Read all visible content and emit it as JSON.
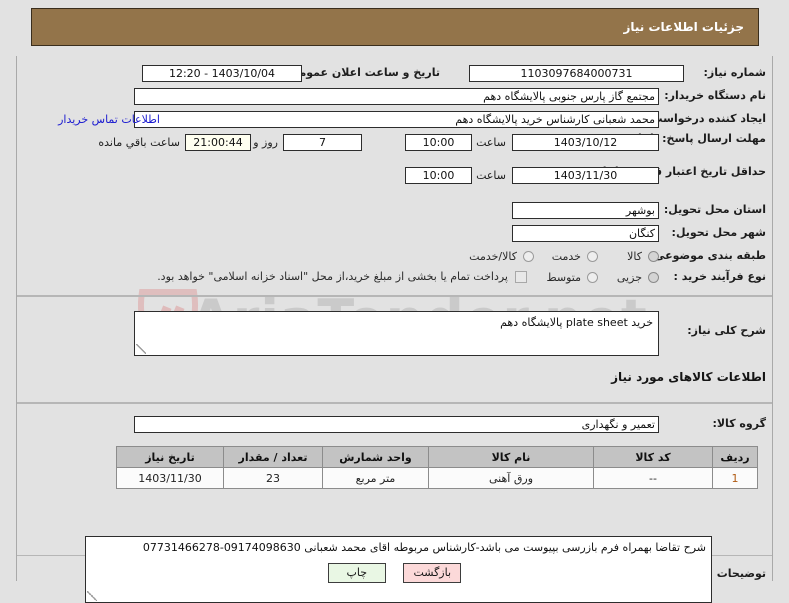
{
  "header": {
    "title": "جزئیات اطلاعات نیاز"
  },
  "info": {
    "need_number": {
      "label": "شماره نیاز:",
      "value": "1103097684000731"
    },
    "announce_datetime": {
      "label": "تاریخ و ساعت اعلان عمومی:",
      "value": "1403/10/04 - 12:20"
    },
    "buyer_org": {
      "label": "نام دستگاه خریدار:",
      "value": "مجتمع گاز پارس جنوبی  پالایشگاه دهم"
    },
    "creator": {
      "label": "ایجاد کننده درخواست:",
      "value": "محمد شعبانی کارشناس خرید پالایشگاه دهم"
    },
    "contact_link": "اطلاعات تماس خریدار",
    "answer_deadline": {
      "label": "مهلت ارسال پاسخ: تا تاریخ:",
      "date": "1403/10/12",
      "time_label": "ساعت",
      "time": "10:00",
      "days": "7",
      "days_label": "روز و",
      "countdown": "21:00:44",
      "countdown_label": "ساعت باقي مانده"
    },
    "price_validity": {
      "label": "حداقل تاریخ اعتبار قیمت: تا تاریخ:",
      "date": "1403/11/30",
      "time_label": "ساعت",
      "time": "10:00"
    },
    "province": {
      "label": "استان محل تحویل:",
      "value": "بوشهر"
    },
    "city": {
      "label": "شهر محل تحویل:",
      "value": "کنگان"
    },
    "subject_category": {
      "label": "طبقه بندی موضوعی:",
      "options": [
        "کالا",
        "خدمت",
        "کالا/خدمت"
      ],
      "selected": "کالا"
    },
    "purchase_process": {
      "label": "نوع فرآیند خرید :",
      "options": [
        "جزیی",
        "متوسط"
      ],
      "selected": "جزیی"
    },
    "treasury_note": {
      "text": "پرداخت تمام یا بخشی از مبلغ خرید،از محل \"اسناد خزانه اسلامی\" خواهد بود.",
      "checked": false
    }
  },
  "description": {
    "label": "شرح کلی نیاز:",
    "value": "خرید plate sheet پالایشگاه دهم"
  },
  "goods": {
    "section_title": "اطلاعات کالاهای مورد نیاز",
    "group_label": "گروه کالا:",
    "group_value": "تعمیر و نگهداری",
    "columns": [
      "ردیف",
      "کد کالا",
      "نام کالا",
      "واحد شمارش",
      "تعداد / مقدار",
      "تاریخ نیاز"
    ],
    "rows": [
      {
        "index": "1",
        "code": "--",
        "name": "ورق آهنی",
        "unit": "متر مربع",
        "quantity": "23",
        "need_date": "1403/11/30"
      }
    ]
  },
  "buyer_notes": {
    "label": "توضیحات خریدار:",
    "value": "شرح تقاضا بهمراه فرم بازرسی بپیوست می باشد-کارشناس مربوطه اقای محمد شعبانی 09174098630-07731466278"
  },
  "buttons": {
    "back": "بازگشت",
    "print": "چاپ"
  },
  "watermark": {
    "text": "AriaTender.net"
  },
  "colors": {
    "header_bg": "#93744a",
    "page_bg": "#e2e2e2",
    "link": "#1a1ad0",
    "back_btn": "#fcd9d9",
    "print_btn": "#e9f7e4",
    "countdown_bg": "#fffff0"
  }
}
